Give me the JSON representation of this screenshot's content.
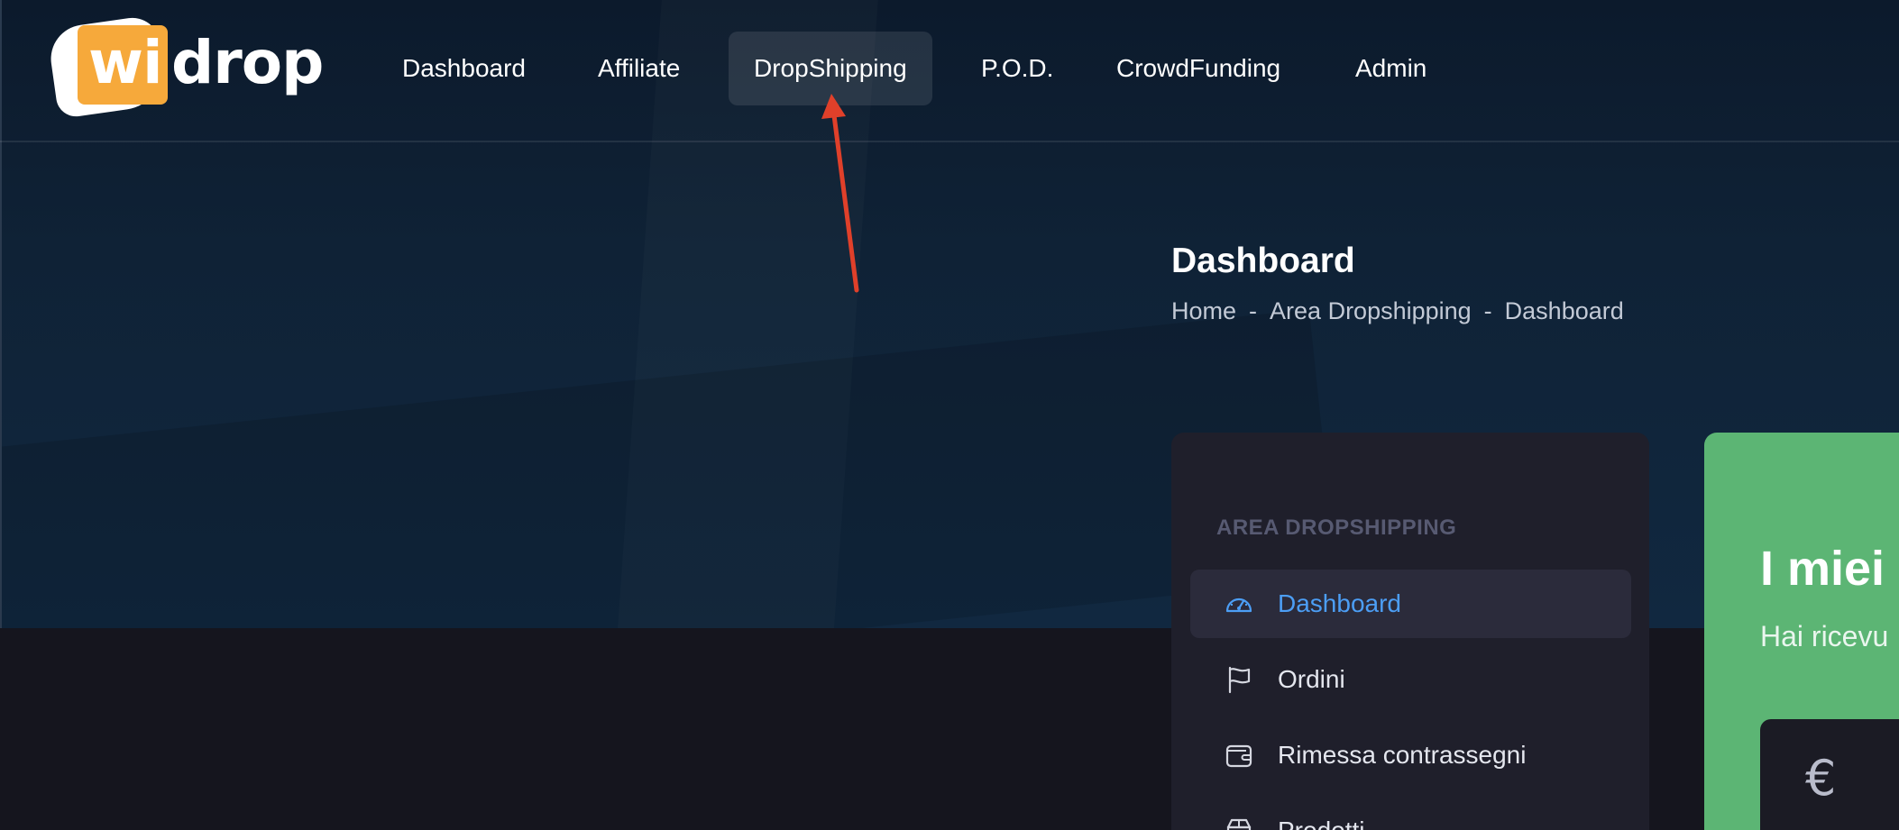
{
  "brand": {
    "logo_prefix": "wi",
    "logo_suffix": "drop",
    "logo_accent": "#f6a93b"
  },
  "nav": {
    "items": [
      {
        "label": "Dashboard"
      },
      {
        "label": "Affiliate"
      },
      {
        "label": "DropShipping"
      },
      {
        "label": "P.O.D."
      },
      {
        "label": "CrowdFunding"
      },
      {
        "label": "Admin"
      }
    ],
    "active": "DropShipping"
  },
  "page": {
    "title": "Dashboard",
    "breadcrumb": [
      "Home",
      "Area Dropshipping",
      "Dashboard"
    ],
    "breadcrumb_separator": "-"
  },
  "sidebar": {
    "heading": "AREA DROPSHIPPING",
    "items": [
      {
        "label": "Dashboard",
        "icon": "speedometer-icon",
        "active": true
      },
      {
        "label": "Ordini",
        "icon": "flag-icon"
      },
      {
        "label": "Rimessa contrassegni",
        "icon": "wallet-icon"
      },
      {
        "label": "Prodotti",
        "icon": "box-icon"
      }
    ],
    "active_color": "#4c9ef5"
  },
  "card": {
    "title": "I miei",
    "subtitle": "Hai ricevu",
    "currency_symbol": "€",
    "color": "#5cb574"
  },
  "annotation": {
    "color": "#e0402a",
    "points_to": "DropShipping"
  }
}
